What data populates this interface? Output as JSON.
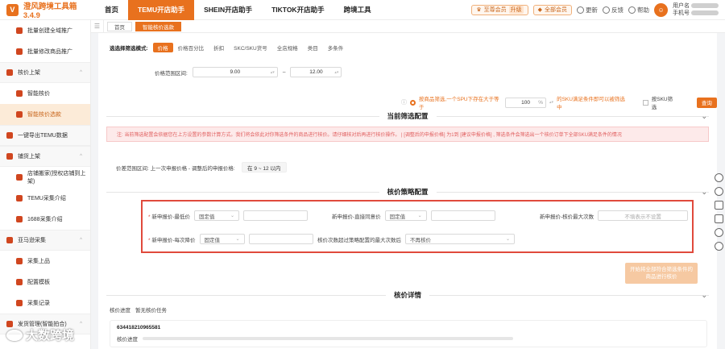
{
  "app": {
    "title": "澄风跨境工具箱 3.4.9",
    "logo_char": "V"
  },
  "nav": [
    {
      "label": "首页",
      "active": false
    },
    {
      "label": "TEMU开店助手",
      "active": true
    },
    {
      "label": "SHEIN开店助手",
      "active": false
    },
    {
      "label": "TIKTOK开店助手",
      "active": false
    },
    {
      "label": "跨境工具",
      "active": false
    }
  ],
  "topbar": {
    "vip_label": "至尊会员",
    "vip_tag": "升级",
    "all_vip_label": "全部会员",
    "update_label": "更新",
    "feedback_label": "反馈",
    "help_label": "帮助",
    "user_line1": "用户名",
    "user_line2": "手机号"
  },
  "sidebar": [
    {
      "label": "批量创建全域推广",
      "level": 2,
      "active": false
    },
    {
      "label": "批量修改商品推广",
      "level": 2,
      "active": false
    },
    {
      "label": "核价上架",
      "level": 1,
      "active": false,
      "chevron": "^"
    },
    {
      "label": "智能核价",
      "level": 2,
      "active": false
    },
    {
      "label": "智能核价选款",
      "level": 2,
      "active": true
    },
    {
      "label": "一键导出TEMU数据",
      "level": 1,
      "active": false,
      "chevron": ""
    },
    {
      "label": "铺货上架",
      "level": 1,
      "active": false,
      "chevron": "^"
    },
    {
      "label": "店铺搬家(授权店铺到上架)",
      "level": 2,
      "active": false
    },
    {
      "label": "TEMU采集介绍",
      "level": 2,
      "active": false
    },
    {
      "label": "1688采集介绍",
      "level": 2,
      "active": false
    },
    {
      "label": "亚马逊采集",
      "level": 1,
      "active": false,
      "chevron": "^"
    },
    {
      "label": "采集上品",
      "level": 2,
      "active": false
    },
    {
      "label": "配置模板",
      "level": 2,
      "active": false
    },
    {
      "label": "采集记录",
      "level": 2,
      "active": false
    },
    {
      "label": "发货管理(智能拍合)",
      "level": 1,
      "active": false,
      "chevron": "^"
    }
  ],
  "tabs": [
    {
      "label": "首页",
      "active": false
    },
    {
      "label": "智能核价选款",
      "active": true
    }
  ],
  "filter": {
    "mode_label": "选选择筛选模式:",
    "modes": [
      {
        "label": "价格",
        "on": true
      },
      {
        "label": "价格百分比",
        "on": false
      },
      {
        "label": "折扣",
        "on": false
      },
      {
        "label": "SKC/SKU货号",
        "on": false
      },
      {
        "label": "全店规格",
        "on": false
      },
      {
        "label": "类目",
        "on": false
      },
      {
        "label": "多条件",
        "on": false
      }
    ],
    "range_label": "价格范围区间:",
    "min": "9.00",
    "max": "12.00",
    "sep": "–"
  },
  "spu_rule": {
    "text1": "按商品筛选,一个SPU下存在大于等于",
    "value": "100",
    "unit": "%",
    "text2": "的SKU满足条件即可以被筛选中",
    "sku_filter_label": "按SKU筛选",
    "query_button": "查询"
  },
  "current_filter": {
    "title": "当前筛选配置",
    "warning": "注: 当前筛选配置会依据您在上方设置的参数计算方式。我们将会依此对你筛选条件的商品进行核价。请仔细核对后再进行核价操作。 | [调整后的申报价格] 为1到 [建议申报价格] , 筛选条件会筛选出一个核价订单下全部SKU满足条件的情况",
    "summary_label": "价差范围区间: 上一次申报价格 - 调整后的申报价格:",
    "summary_value": "在 9 ~ 12 以内"
  },
  "strategy": {
    "title": "核价策略配置",
    "row1": [
      {
        "label": "新申报价-最低价",
        "select": "固定值",
        "required": true
      },
      {
        "label": "新申报价-直接同意价",
        "select": "固定值",
        "required": false
      },
      {
        "label": "新申报价-核价最大次数",
        "input_placeholder": "不填表示不设置",
        "required": false
      }
    ],
    "row2": [
      {
        "label": "新申报价-每次降价",
        "select": "固定值",
        "required": true
      },
      {
        "label": "核价次数超过策略配置的最大次数后",
        "select": "不再核价",
        "required": false
      }
    ],
    "start_button": "开始将全部符合筛选条件的商品进行核价"
  },
  "detail": {
    "title": "核价详情",
    "progress_label": "核价进度",
    "no_task": "暂无核价任务",
    "order_id": "634418210965581",
    "item_progress_label": "核价进度",
    "progress_fraction": 0.0
  },
  "watermark": "大数跨境",
  "colors": {
    "accent": "#e8711e",
    "highlight": "#e04a3c",
    "warning_bg": "#fdeaea"
  }
}
